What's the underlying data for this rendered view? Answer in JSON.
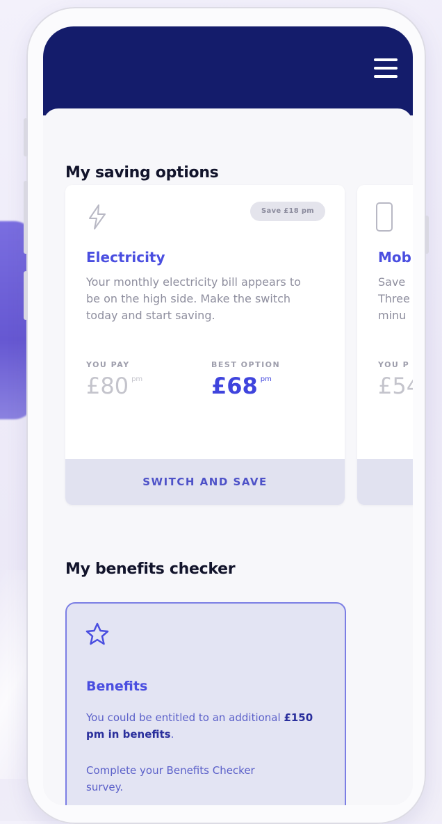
{
  "header": {
    "menu_icon": "hamburger-menu-icon"
  },
  "saving_options": {
    "title": "My saving options",
    "cards": [
      {
        "icon": "lightning-icon",
        "badge": "Save £18 pm",
        "name": "Electricity",
        "description": "Your monthly electricity bill appears to be on the high side. Make the switch today and start saving.",
        "you_pay_label": "YOU PAY",
        "you_pay_value": "£80",
        "best_option_label": "BEST OPTION",
        "best_option_value": "£68",
        "unit": "pm",
        "cta": "SWITCH AND SAVE"
      },
      {
        "icon": "mobile-phone-icon",
        "name": "Mob",
        "description_lines": [
          "Save",
          "Three",
          "minu"
        ],
        "you_pay_label": "YOU P",
        "you_pay_value": "£54"
      }
    ]
  },
  "benefits": {
    "title": "My benefits checker",
    "card": {
      "icon": "star-icon",
      "name": "Benefits",
      "text_prefix": "You could be entitled to an additional ",
      "text_bold": "£150 pm in benefits",
      "text_suffix": ".",
      "secondary_text": "Complete your Benefits Checker survey."
    }
  },
  "colors": {
    "header": "#141c6b",
    "accent": "#4a4ee0",
    "button_bg": "#e1e2f0"
  }
}
